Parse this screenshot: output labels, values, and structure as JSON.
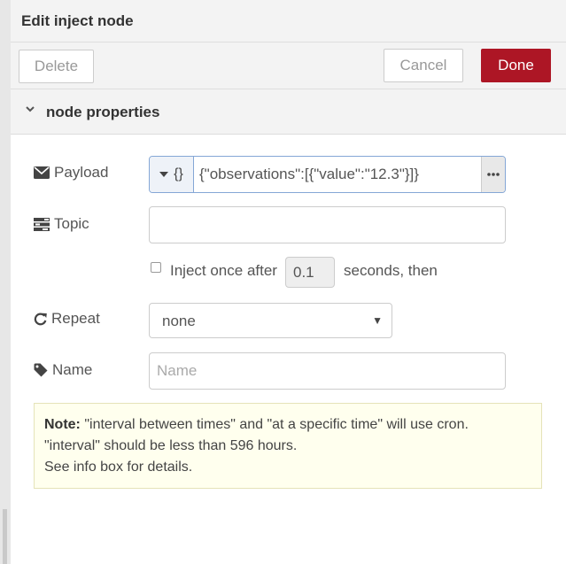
{
  "tray": {
    "title": "Edit inject node"
  },
  "toolbar": {
    "delete_label": "Delete",
    "cancel_label": "Cancel",
    "done_label": "Done",
    "done_color": "#ad1625"
  },
  "section": {
    "title": "node properties"
  },
  "payload": {
    "label": "Payload",
    "type_label": "{}",
    "value": "{\"observations\":[{\"value\":\"12.3\"}]}"
  },
  "topic": {
    "label": "Topic",
    "value": ""
  },
  "inject_once": {
    "label": "Inject once after",
    "checked": false,
    "delay": "0.1",
    "suffix": "seconds, then"
  },
  "repeat": {
    "label": "Repeat",
    "value": "none"
  },
  "name": {
    "label": "Name",
    "placeholder": "Name",
    "value": ""
  },
  "note": {
    "bold": "Note:",
    "line1": "\"interval between times\" and \"at a specific time\" will use cron.",
    "line2": "\"interval\" should be less than 596 hours.",
    "line3": "See info box for details."
  }
}
